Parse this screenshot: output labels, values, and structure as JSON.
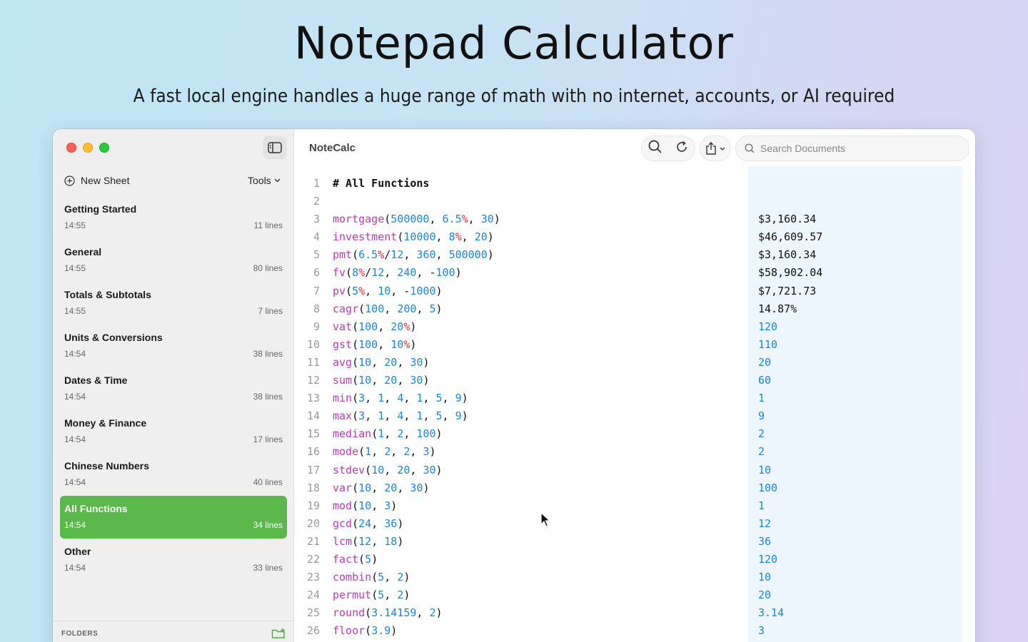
{
  "hero": {
    "title": "Notepad Calculator",
    "subtitle": "A fast local engine handles a huge range of math with no internet, accounts, or AI required"
  },
  "sidebar": {
    "new_sheet": "New Sheet",
    "tools": "Tools",
    "folders": "FOLDERS",
    "docs": [
      {
        "title": "Getting Started",
        "time": "14:55",
        "lines": "11 lines",
        "active": false
      },
      {
        "title": "General",
        "time": "14:55",
        "lines": "80 lines",
        "active": false
      },
      {
        "title": "Totals & Subtotals",
        "time": "14:55",
        "lines": "7 lines",
        "active": false
      },
      {
        "title": "Units & Conversions",
        "time": "14:54",
        "lines": "38 lines",
        "active": false
      },
      {
        "title": "Dates & Time",
        "time": "14:54",
        "lines": "38 lines",
        "active": false
      },
      {
        "title": "Money & Finance",
        "time": "14:54",
        "lines": "17 lines",
        "active": false
      },
      {
        "title": "Chinese Numbers",
        "time": "14:54",
        "lines": "40 lines",
        "active": false
      },
      {
        "title": "All Functions",
        "time": "14:54",
        "lines": "34 lines",
        "active": true
      },
      {
        "title": "Other",
        "time": "14:54",
        "lines": "33 lines",
        "active": false
      }
    ]
  },
  "toolbar": {
    "app_name": "NoteCalc",
    "search_placeholder": "Search Documents"
  },
  "editor": {
    "lines": [
      {
        "n": "1",
        "text": "# All Functions",
        "result": ""
      },
      {
        "n": "2",
        "text": "",
        "result": ""
      },
      {
        "n": "3",
        "text": "mortgage(500000, 6.5%, 30)",
        "result": "$3,160.34"
      },
      {
        "n": "4",
        "text": "investment(10000, 8%, 20)",
        "result": "$46,609.57"
      },
      {
        "n": "5",
        "text": "pmt(6.5%/12, 360, 500000)",
        "result": "$3,160.34"
      },
      {
        "n": "6",
        "text": "fv(8%/12, 240, -100)",
        "result": "$58,902.04"
      },
      {
        "n": "7",
        "text": "pv(5%, 10, -1000)",
        "result": "$7,721.73"
      },
      {
        "n": "8",
        "text": "cagr(100, 200, 5)",
        "result": "14.87%"
      },
      {
        "n": "9",
        "text": "vat(100, 20%)",
        "result": "120"
      },
      {
        "n": "10",
        "text": "gst(100, 10%)",
        "result": "110"
      },
      {
        "n": "11",
        "text": "avg(10, 20, 30)",
        "result": "20"
      },
      {
        "n": "12",
        "text": "sum(10, 20, 30)",
        "result": "60"
      },
      {
        "n": "13",
        "text": "min(3, 1, 4, 1, 5, 9)",
        "result": "1"
      },
      {
        "n": "14",
        "text": "max(3, 1, 4, 1, 5, 9)",
        "result": "9"
      },
      {
        "n": "15",
        "text": "median(1, 2, 100)",
        "result": "2"
      },
      {
        "n": "16",
        "text": "mode(1, 2, 2, 3)",
        "result": "2"
      },
      {
        "n": "17",
        "text": "stdev(10, 20, 30)",
        "result": "10"
      },
      {
        "n": "18",
        "text": "var(10, 20, 30)",
        "result": "100"
      },
      {
        "n": "19",
        "text": "mod(10, 3)",
        "result": "1"
      },
      {
        "n": "20",
        "text": "gcd(24, 36)",
        "result": "12"
      },
      {
        "n": "21",
        "text": "lcm(12, 18)",
        "result": "36"
      },
      {
        "n": "22",
        "text": "fact(5)",
        "result": "120"
      },
      {
        "n": "23",
        "text": "combin(5, 2)",
        "result": "10"
      },
      {
        "n": "24",
        "text": "permut(5, 2)",
        "result": "20"
      },
      {
        "n": "25",
        "text": "round(3.14159, 2)",
        "result": "3.14"
      },
      {
        "n": "26",
        "text": "floor(3.9)",
        "result": "3"
      }
    ]
  },
  "colors": {
    "accent_green": "#5ab94a",
    "function_magenta": "#b83bb0",
    "number_blue": "#1a86d6",
    "percent_red": "#e0313e"
  },
  "icons": [
    "sidebar-toggle-icon",
    "plus-circle-icon",
    "chevron-down-icon",
    "search-icon",
    "refresh-icon",
    "share-icon",
    "new-folder-icon"
  ]
}
